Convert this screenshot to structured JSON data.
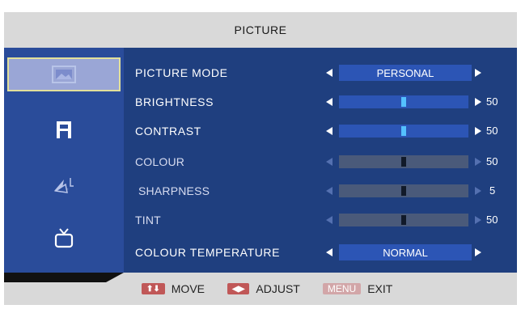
{
  "title": "PICTURE",
  "sidebar": [
    {
      "icon": "picture-icon",
      "selected": true
    },
    {
      "icon": "setup-icon",
      "selected": false
    },
    {
      "icon": "pointer-icon",
      "selected": false
    },
    {
      "icon": "tv-icon",
      "selected": false
    }
  ],
  "rows": [
    {
      "label": "PICTURE MODE",
      "type": "select",
      "value": "PERSONAL",
      "enabled": true
    },
    {
      "label": "BRIGHTNESS",
      "type": "slider",
      "value": "50",
      "level": 50,
      "enabled": true
    },
    {
      "label": "CONTRAST",
      "type": "slider",
      "value": "50",
      "level": 50,
      "enabled": true
    },
    {
      "label": "COLOUR",
      "type": "slider",
      "value": "50",
      "level": 50,
      "enabled": false
    },
    {
      "label": "SHARPNESS",
      "type": "slider",
      "value": "5",
      "level": 50,
      "enabled": false
    },
    {
      "label": "TINT",
      "type": "slider",
      "value": "50",
      "level": 50,
      "enabled": false
    },
    {
      "label": "COLOUR TEMPERATURE",
      "type": "select",
      "value": "NORMAL",
      "enabled": true
    }
  ],
  "footer": {
    "move_key": "⬆⬇",
    "move_label": "MOVE",
    "adjust_key": "◀▶",
    "adjust_label": "ADJUST",
    "exit_key": "MENU",
    "exit_label": "EXIT"
  },
  "colors": {
    "panel": "#1f3f7f",
    "sidebar": "#2a4c9a",
    "highlight": "#2c55b5",
    "thumb_active": "#54c0ff"
  }
}
